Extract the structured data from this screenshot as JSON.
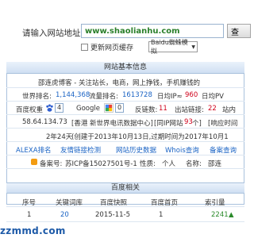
{
  "query": {
    "label": "请输入网站地址:",
    "url": "www.shaolianhu.com",
    "button": "查",
    "cache_label": "更新网页缓存",
    "engine_value": "Baidu蜘蛛模拟"
  },
  "info": {
    "header": "网站基本信息",
    "slogan": "邵连虎博客 - 关注站长，电商，网上挣钱，手机赚钱的",
    "world_rank_label": "世界排名:",
    "world_rank": "1,144,368",
    "traffic_label": "流量排名:",
    "traffic": "1613728",
    "daily_ip_label": "日均IP≈",
    "daily_ip": "960",
    "daily_pv_label": "日均PV",
    "baidu_weight_label": "百度权重",
    "baidu_weight": "4",
    "google_label": "Google",
    "google_pr": "0",
    "backlinks_label": "反链数:",
    "backlinks": "11",
    "outlinks_label": "出站链接:",
    "outlinks": "22",
    "site_label": "站内",
    "server_ip": "58.64.134.73",
    "server_location": "[香港 新世界电讯数据中心]",
    "same_ip_prefix": "[同IP网站",
    "same_ip_count": "93",
    "same_ip_suffix": "个]",
    "response_label": "[响应时间",
    "domain_age": "2年24天",
    "domain_dates": "(创建于2013年10月13日,过期时间为2017年10月1",
    "tools": [
      "ALEXA排名",
      "友情链接检测",
      "网站历史数据",
      "Whois查询",
      "备案查询"
    ],
    "icp_label": "备案号:",
    "icp_value": "苏ICP备15027501号-1",
    "nature_label": "性质:",
    "nature_value": "个人",
    "name_label": "名称:",
    "name_value": "邵连"
  },
  "baidu": {
    "title": "百度相关",
    "headers": [
      "序号",
      "关键词库",
      "百度快照",
      "百度首页",
      "索引量"
    ],
    "rows": [
      {
        "seq": "1",
        "keyword_count": "20",
        "snapshot": "2015-11-5",
        "home": "1",
        "index": "2241"
      }
    ]
  },
  "watermark": "zzmmd.com",
  "colors": {
    "accent_blue": "#1a63c4",
    "alert_red": "#d0021b",
    "header_bg": "#cfdff2"
  }
}
